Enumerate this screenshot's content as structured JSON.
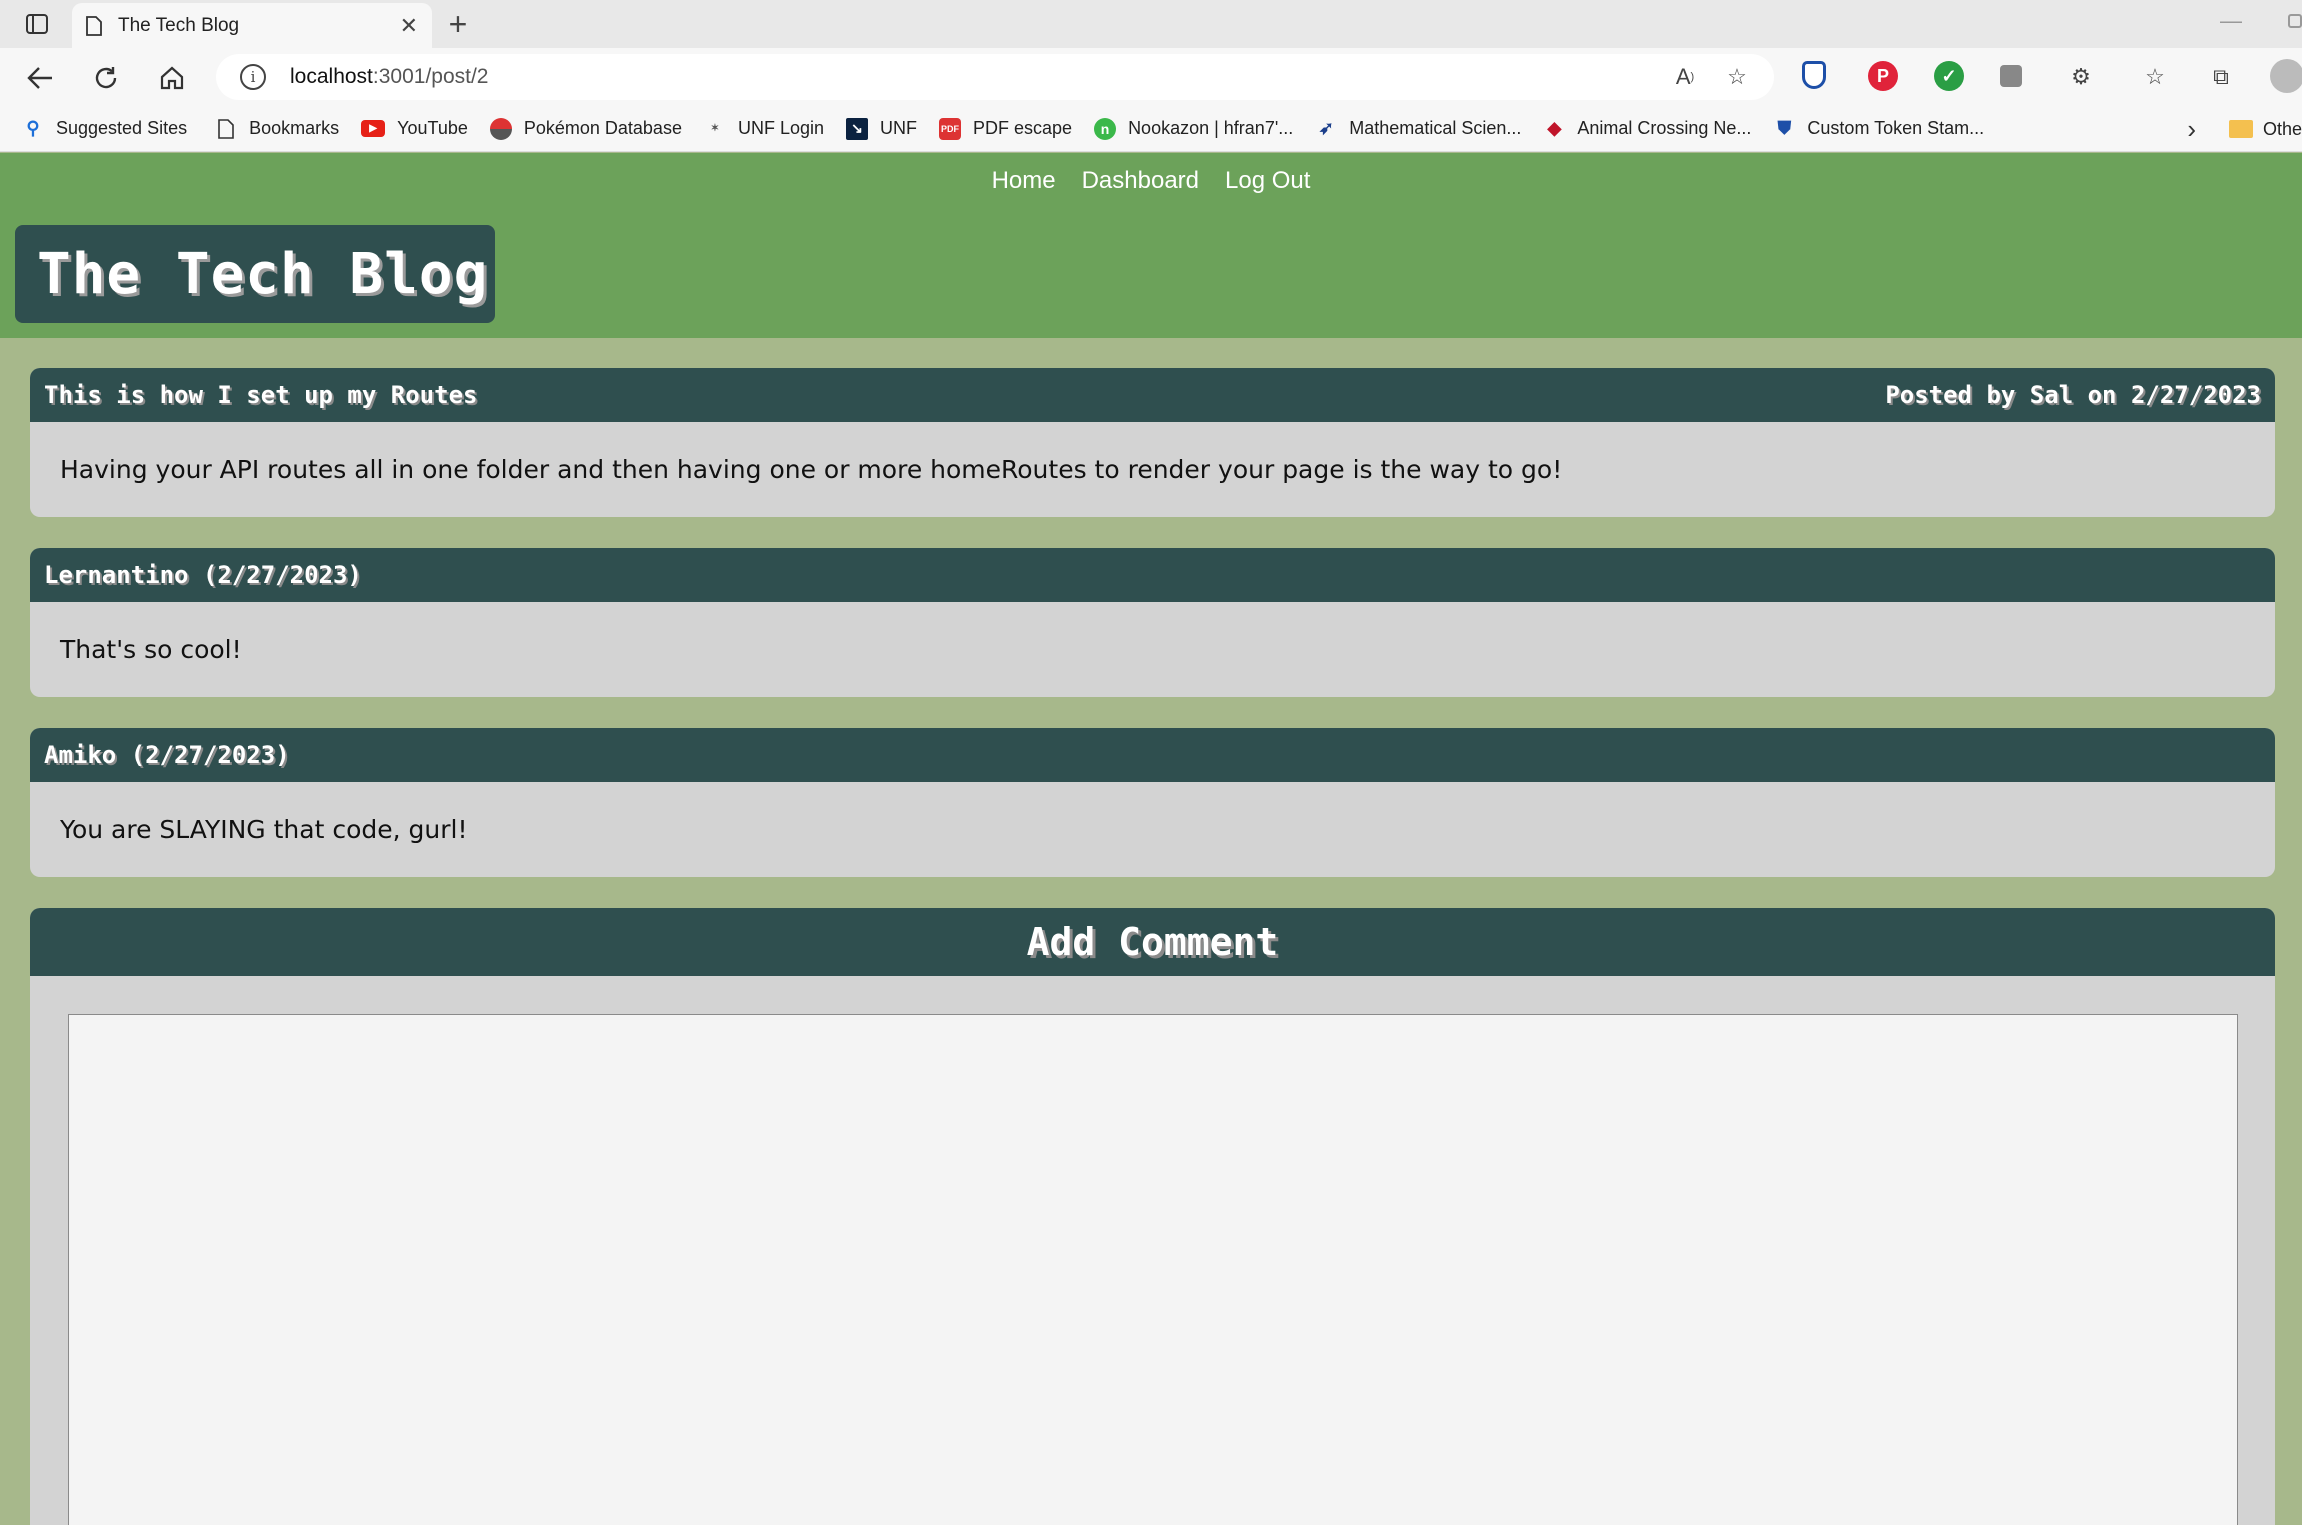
{
  "browser": {
    "tab_title": "The Tech Blog",
    "url_host": "localhost",
    "url_path": ":3001/post/2",
    "bookmarks": [
      {
        "label": "Suggested Sites",
        "icon": "search-icon"
      },
      {
        "label": "Bookmarks",
        "icon": "page-icon"
      },
      {
        "label": "YouTube",
        "icon": "youtube-icon"
      },
      {
        "label": "Pokémon Database",
        "icon": "pokeball-icon"
      },
      {
        "label": "UNF Login",
        "icon": "unf-icon"
      },
      {
        "label": "UNF",
        "icon": "unf-osprey-icon"
      },
      {
        "label": "PDF escape",
        "icon": "pdf-icon"
      },
      {
        "label": "Nookazon | hfran7'...",
        "icon": "nookazon-icon"
      },
      {
        "label": "Mathematical Scien...",
        "icon": "bird-icon"
      },
      {
        "label": "Animal Crossing Ne...",
        "icon": "leaf-icon"
      },
      {
        "label": "Custom Token Stam...",
        "icon": "shield-icon"
      }
    ],
    "other_bookmarks": "Othe"
  },
  "site": {
    "nav": {
      "home": "Home",
      "dashboard": "Dashboard",
      "logout": "Log Out"
    },
    "title": "The Tech Blog"
  },
  "post": {
    "title": "This is how I set up my Routes",
    "meta": "Posted by Sal on 2/27/2023",
    "body": "Having your API routes all in one folder and then having one or more homeRoutes to render your page is the way to go!"
  },
  "comments": [
    {
      "header": "Lernantino (2/27/2023)",
      "body": "That's so cool!"
    },
    {
      "header": "Amiko (2/27/2023)",
      "body": "You are SLAYING that code, gurl!"
    }
  ],
  "comment_form": {
    "title": "Add Comment",
    "value": ""
  },
  "colors": {
    "header_green": "#6ca25a",
    "page_bg": "#a7b88b",
    "card_dark": "#2f4f4f",
    "card_body": "#d3d3d3"
  }
}
